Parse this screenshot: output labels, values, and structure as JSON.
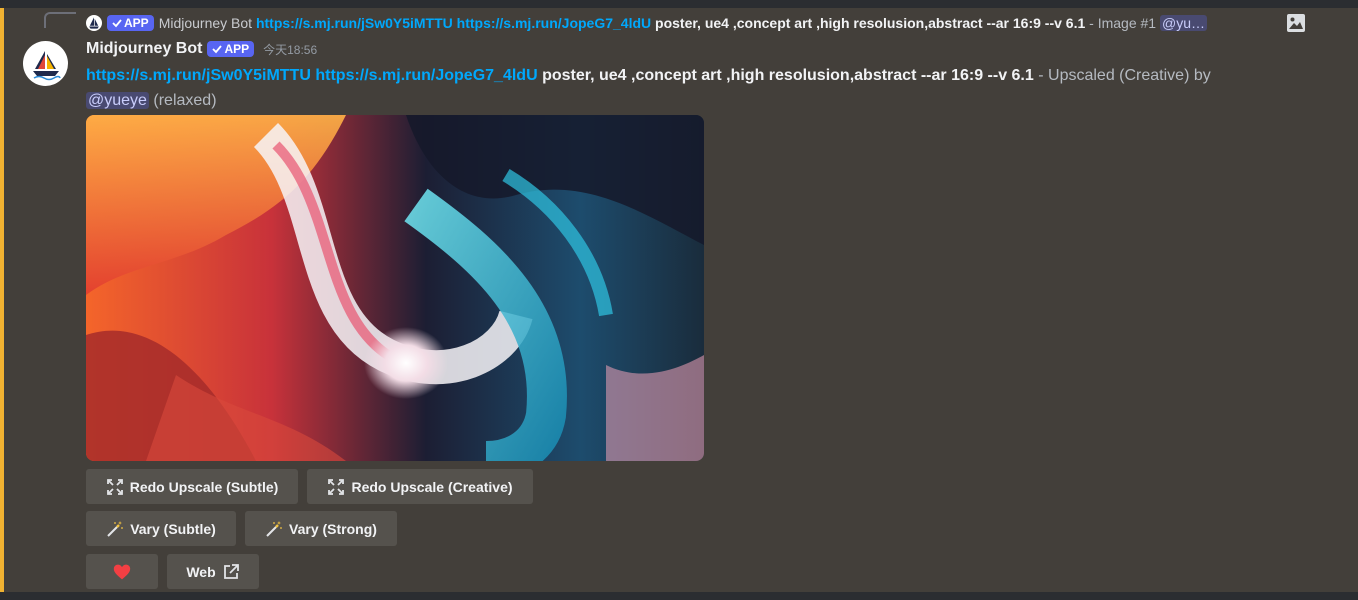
{
  "reply": {
    "author": "Midjourney Bot",
    "app_badge": "APP",
    "link1": "https://s.mj.run/jSw0Y5iMTTU",
    "link2": "https://s.mj.run/JopeG7_4ldU",
    "prompt": "poster, ue4 ,concept art ,high resolusion,abstract --ar 16:9 --v 6.1",
    "suffix": "- Image #1",
    "mention": "@yu…",
    "image_icon": "image-icon"
  },
  "message": {
    "author": "Midjourney Bot",
    "app_badge": "APP",
    "timestamp": "今天18:56",
    "link1": "https://s.mj.run/jSw0Y5iMTTU",
    "link2": "https://s.mj.run/JopeG7_4ldU",
    "prompt": "poster, ue4 ,concept art ,high resolusion,abstract --ar 16:9 --v 6.1",
    "status": "- Upscaled (Creative) by",
    "mention": "@yueye",
    "mode": "(relaxed)"
  },
  "buttons": {
    "redo_subtle": "Redo Upscale (Subtle)",
    "redo_creative": "Redo Upscale (Creative)",
    "vary_subtle": "Vary (Subtle)",
    "vary_strong": "Vary (Strong)",
    "web": "Web"
  },
  "colors": {
    "accent_bar": "#f0b232",
    "link": "#00a8fc",
    "badge": "#5865f2",
    "heart": "#f23f43"
  }
}
